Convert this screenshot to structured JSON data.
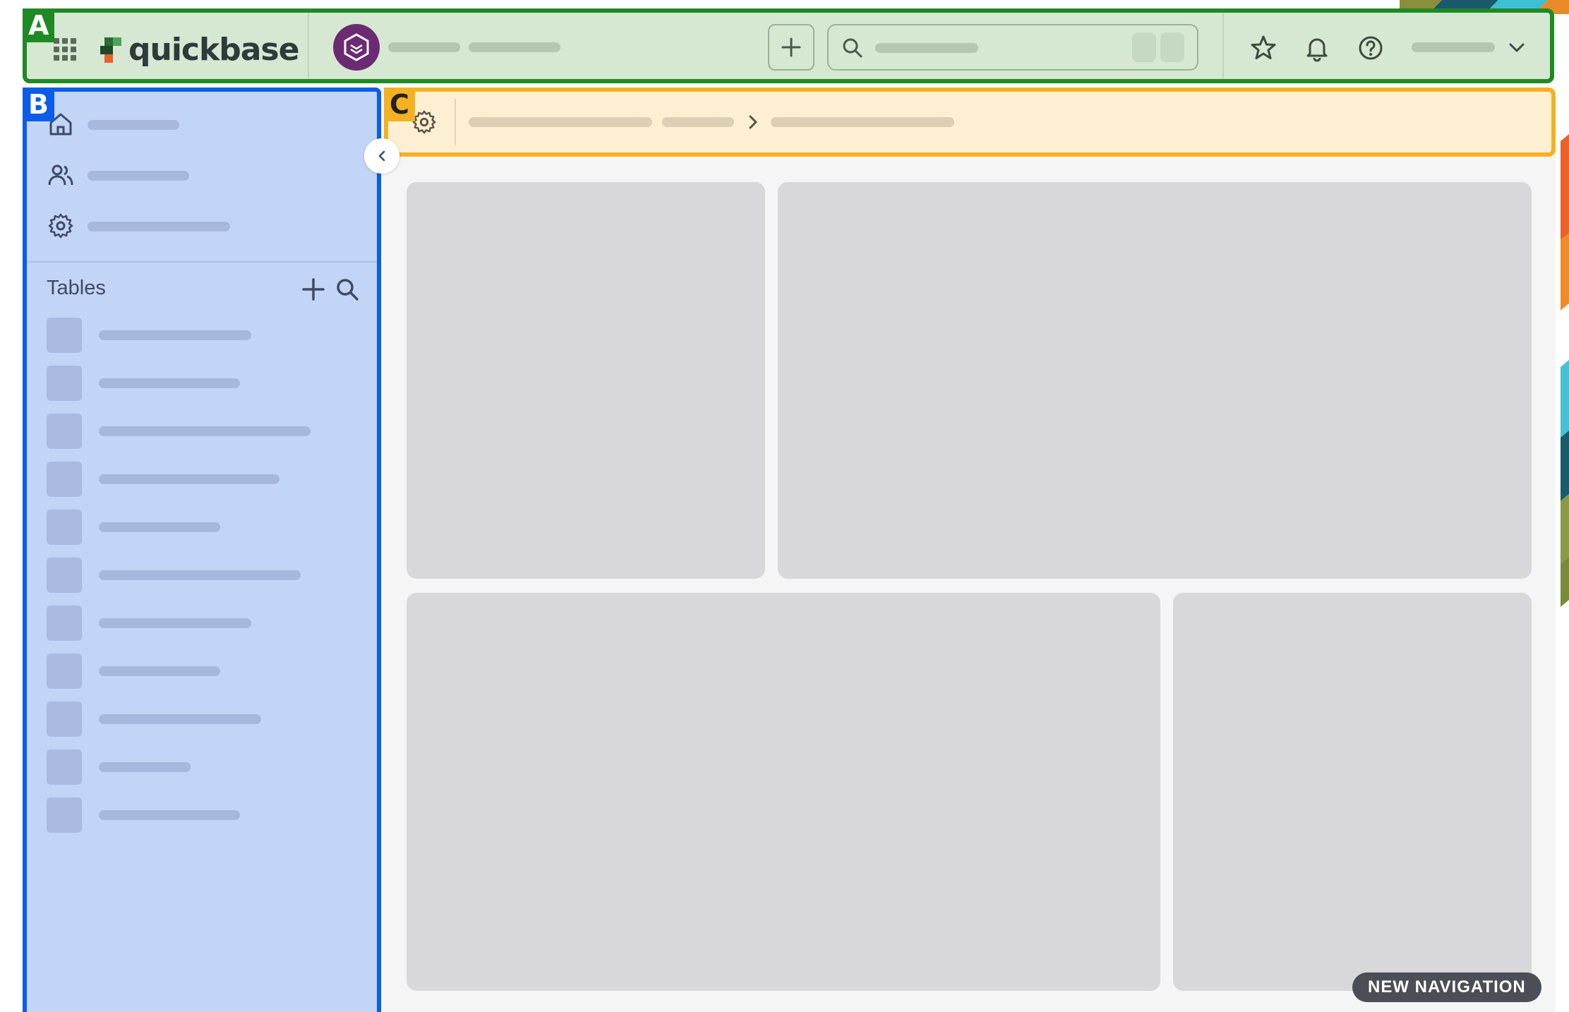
{
  "colors": {
    "header_fill": "#d6e8d2",
    "header_border": "#1f8a23",
    "sidebar_fill": "#c3d5f6",
    "sidebar_border": "#0a5de8",
    "breadcrumb_fill": "#fdefd2",
    "breadcrumb_border": "#f4b122",
    "app_avatar": "#6b2b72",
    "card_placeholder": "#d8d8da",
    "badge_dark": "#4b4e55"
  },
  "regions": {
    "header": "A",
    "sidebar": "B",
    "breadcrumb": "C"
  },
  "header": {
    "logo_text": "quickbase",
    "icons": [
      "apps-grid-icon",
      "app-avatar-icon",
      "plus-icon",
      "search-icon",
      "star-icon",
      "bell-icon",
      "help-icon",
      "chevron-down-icon"
    ]
  },
  "sidebar": {
    "nav_icons": [
      "home-icon",
      "users-icon",
      "settings-icon"
    ],
    "tables_label": "Tables",
    "tables_icons": [
      "plus-icon",
      "search-icon"
    ],
    "table_item_count": 11
  },
  "breadcrumb": {
    "icons": [
      "settings-icon",
      "chevron-right-icon"
    ]
  },
  "badge": {
    "new_navigation": "NEW NAVIGATION"
  }
}
